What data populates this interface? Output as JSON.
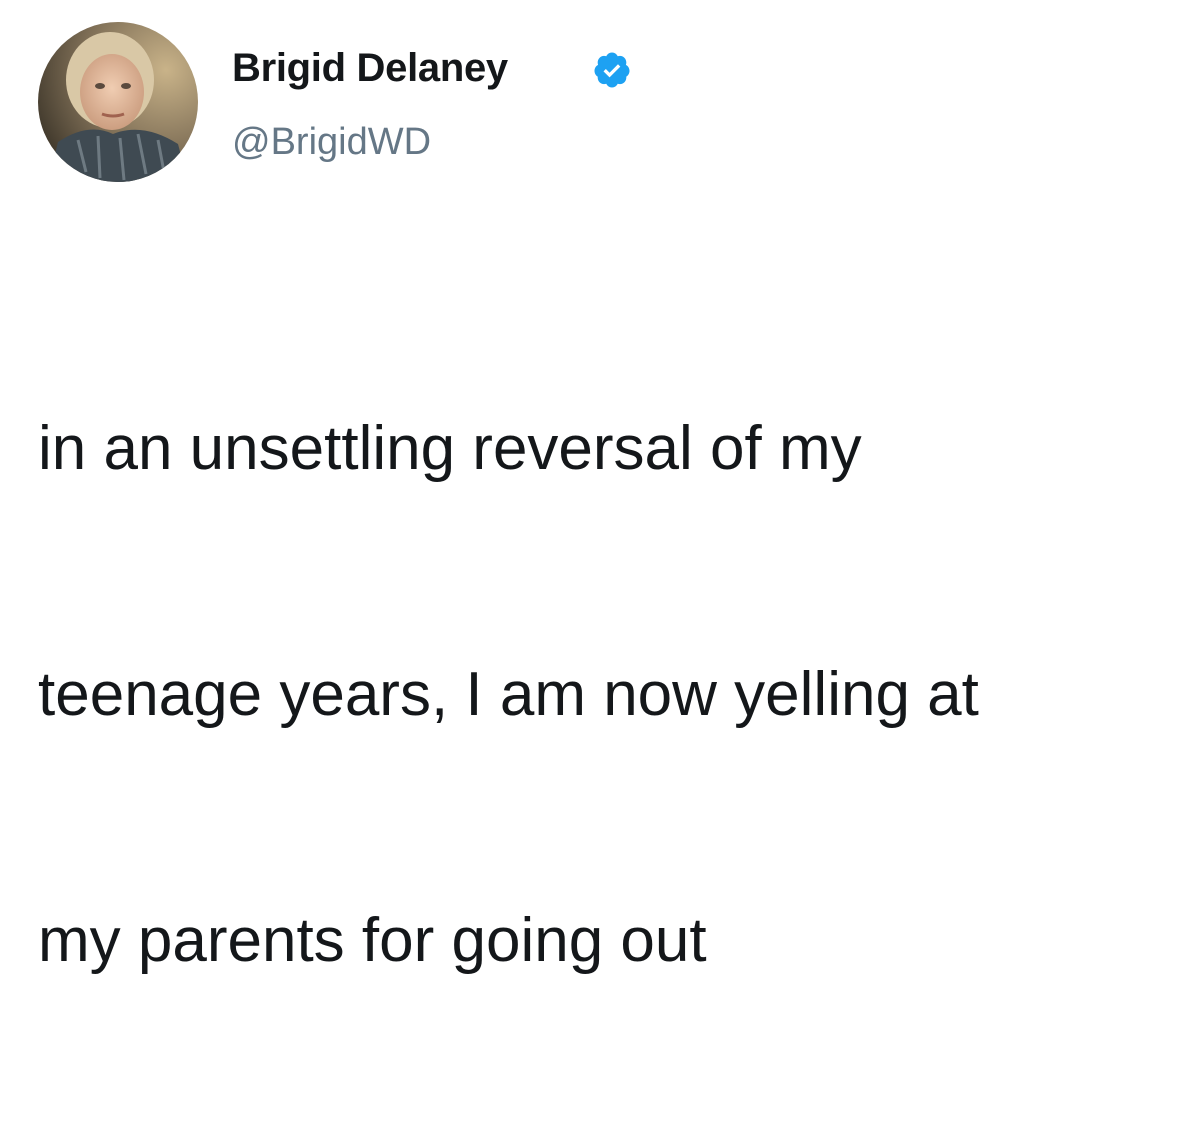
{
  "author": {
    "display_name": "Brigid Delaney",
    "handle": "@BrigidWD",
    "verified": true,
    "verified_color": "#1da1f2"
  },
  "tweet": {
    "lines": [
      "in an unsettling reversal of my",
      "teenage years, I am now yelling at",
      "my parents for going out"
    ],
    "text_color": "#14171a",
    "handle_color": "#657786"
  },
  "icons": {
    "verified_badge": "verified-badge-icon",
    "avatar": "profile-photo"
  }
}
